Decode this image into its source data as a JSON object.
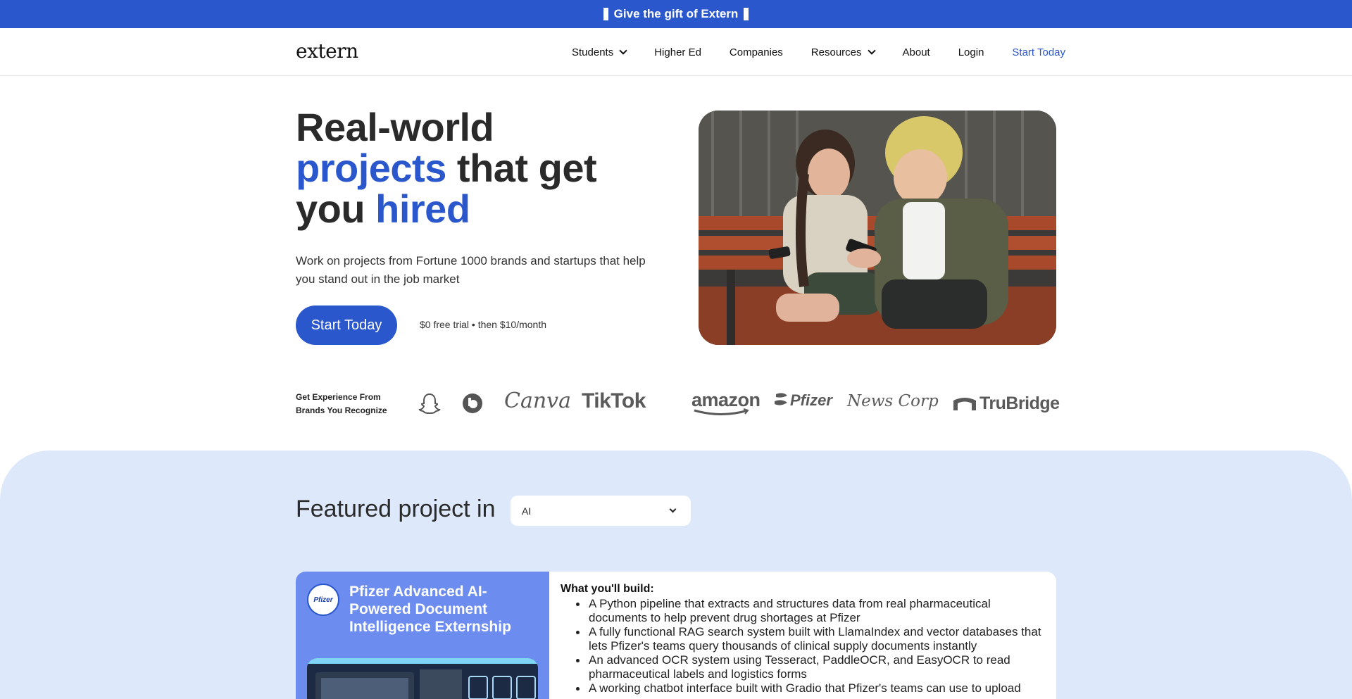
{
  "banner": {
    "text": "Give the gift of Extern"
  },
  "nav": {
    "logo": "extern",
    "items": [
      {
        "label": "Students",
        "dropdown": true
      },
      {
        "label": "Higher Ed",
        "dropdown": false
      },
      {
        "label": "Companies",
        "dropdown": false
      },
      {
        "label": "Resources",
        "dropdown": true
      },
      {
        "label": "About",
        "dropdown": false
      },
      {
        "label": "Login",
        "dropdown": false
      }
    ],
    "cta": "Start Today"
  },
  "hero": {
    "title_part1": "Real-world",
    "title_highlight1": "projects",
    "title_part2": "that get",
    "title_part3": "you",
    "title_highlight2": "hired",
    "subtitle": "Work on projects from Fortune 1000 brands and startups that help you stand out in the job market",
    "button": "Start Today",
    "trial_text": "$0 free trial • then $10/month"
  },
  "brands": {
    "label": "Get Experience From Brands You Recognize",
    "logos": [
      "snapchat-logo",
      "beats-logo",
      "Canva",
      "TikTok",
      "amazon",
      "Pfizer",
      "News Corp",
      "TruBridge"
    ]
  },
  "featured": {
    "heading": "Featured project in",
    "selected_category": "AI"
  },
  "project": {
    "company_logo_text": "Pfizer",
    "title": "Pfizer Advanced AI-Powered Document Intelligence Externship",
    "build_heading": "What you'll build:",
    "build_items": [
      "A Python pipeline that extracts and structures data from real pharmaceutical documents to help prevent drug shortages at Pfizer",
      "A fully functional RAG search system built with LlamaIndex and vector databases that lets Pfizer's teams query thousands of clinical supply documents instantly",
      "An advanced OCR system using Tesseract, PaddleOCR, and EasyOCR to read pharmaceutical labels and logistics forms",
      "A working chatbot interface built with Gradio that Pfizer's teams can use to upload"
    ]
  },
  "colors": {
    "brand_blue": "#2b57cd",
    "section_bg": "#dde8fa",
    "card_accent": "#6c8cf0"
  }
}
